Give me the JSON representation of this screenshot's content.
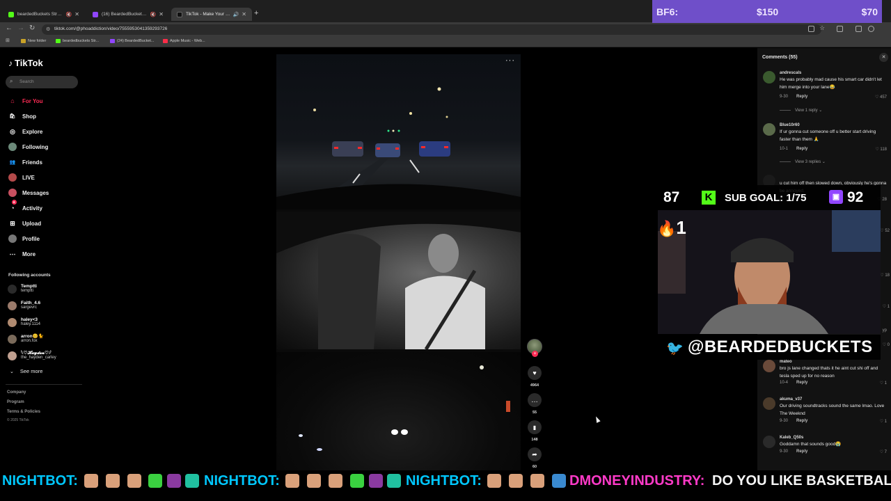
{
  "browser": {
    "tabs": [
      {
        "label": "beardedBuckets Stream - Yo",
        "favicon_color": "#53fc18"
      },
      {
        "label": "(16) BeardedBuckets - Twi",
        "favicon_color": "#9146ff"
      },
      {
        "label": "TikTok - Make Your Day",
        "favicon_color": "#000000"
      }
    ],
    "url": "tiktok.com/@phoaddiction/video/7555953041359293726",
    "bookmarks": [
      {
        "label": "New folder",
        "color": "#c9a227"
      },
      {
        "label": "beardedbuckets Str...",
        "color": "#53fc18"
      },
      {
        "label": "(24) BeardedBucket...",
        "color": "#9146ff"
      },
      {
        "label": "Apple Music - Web...",
        "color": "#fa2d48"
      }
    ]
  },
  "sidebar": {
    "logo": "TikTok",
    "search_placeholder": "Search",
    "nav": [
      {
        "label": "For You",
        "icon": "home-icon",
        "glyph": "⌂"
      },
      {
        "label": "Shop",
        "icon": "shop-icon",
        "glyph": "🛍"
      },
      {
        "label": "Explore",
        "icon": "compass-icon",
        "glyph": "◎"
      },
      {
        "label": "Following",
        "icon": "following-avatar-icon",
        "glyph": "●"
      },
      {
        "label": "Friends",
        "icon": "friends-icon",
        "glyph": "👥"
      },
      {
        "label": "LIVE",
        "icon": "live-icon",
        "glyph": "●"
      },
      {
        "label": "Messages",
        "icon": "messages-icon",
        "glyph": "✉"
      },
      {
        "label": "Activity",
        "icon": "activity-icon",
        "glyph": "◔",
        "badge": "6"
      },
      {
        "label": "Upload",
        "icon": "upload-icon",
        "glyph": "⊞"
      },
      {
        "label": "Profile",
        "icon": "profile-icon",
        "glyph": "●"
      },
      {
        "label": "More",
        "icon": "more-icon",
        "glyph": "⋯"
      }
    ],
    "following_title": "Following accounts",
    "following": [
      {
        "name": "Temptti",
        "handle": "temptti"
      },
      {
        "name": "Faith_4.6",
        "handle": "sargevrc"
      },
      {
        "name": "haley<3",
        "handle": "haley.1114"
      },
      {
        "name": "arron😊🐈",
        "handle": "arron.fox"
      },
      {
        "name": "𓆩♡𝓗𝓪𝔂𝓭𝓮𝓷♡𓆪",
        "handle": "the_hayden_carley"
      }
    ],
    "see_more": "See more",
    "footer": [
      "Company",
      "Program",
      "Terms & Policies"
    ],
    "copyright": "© 2025 TikTok"
  },
  "video": {
    "more_label": "···",
    "actions": [
      {
        "icon": "heart-icon",
        "glyph": "♥",
        "count": "4964"
      },
      {
        "icon": "comment-icon",
        "glyph": "💬",
        "count": "55"
      },
      {
        "icon": "bookmark-icon",
        "glyph": "🔖",
        "count": "148"
      },
      {
        "icon": "share-icon",
        "glyph": "➦",
        "count": "60"
      }
    ]
  },
  "comments": {
    "title": "Comments (55)",
    "items": [
      {
        "user": "andrescals",
        "text": "He was probably mad cause his smart car didn't let him merge into your lane😂",
        "date": "9-30",
        "reply": "Reply",
        "likes": "457"
      },
      {
        "user": "Blue10r60",
        "text": "If ur gonna cut someone off u better start driving faster than them 🙏",
        "date": "10-1",
        "reply": "Reply",
        "likes": "118"
      },
      {
        "user": "",
        "text": "u cut him off then slowed down, obviously he's gonna be annoyed,",
        "date": "",
        "reply": "",
        "likes": "28"
      },
      {
        "user": "mateo",
        "text": "bro js lane changed thats it he aint cut shi off and tesla sped up for no reason",
        "date": "10-4",
        "reply": "Reply",
        "likes": "1"
      },
      {
        "user": "akuma_v37",
        "text": "Our driving soundtracks sound the same lmao. Love The Weeknd",
        "date": "9-30",
        "reply": "Reply",
        "likes": "1"
      },
      {
        "user": "Kaleb_Q50s",
        "text": "Goddamn that sounds good😭",
        "date": "9-30",
        "reply": "Reply",
        "likes": "7"
      }
    ],
    "view_replies": [
      "View 1 reply",
      "View 3 replies"
    ],
    "partial_likes": [
      "52",
      "18",
      "1",
      "0"
    ],
    "partial_labels": [
      "yp"
    ]
  },
  "overlays": {
    "bf6": {
      "label": "BF6:",
      "current": "$150",
      "goal": "$70"
    },
    "subgoal": {
      "left_count": "87",
      "label": "SUB GOAL: 1/75",
      "right_count": "92"
    },
    "streak": "1",
    "twitter_handle": "@BEARDEDBUCKETS",
    "ticker": [
      {
        "kind": "nb",
        "text": "NIGHTBOT:"
      },
      {
        "kind": "nb",
        "text": "NIGHTBOT:"
      },
      {
        "kind": "nb",
        "text": "NIGHTBOT:"
      },
      {
        "kind": "dm",
        "text": "DMONEYINDUSTRY:"
      },
      {
        "kind": "msg",
        "text": "DO YOU LIKE BASKETBALL"
      }
    ]
  }
}
